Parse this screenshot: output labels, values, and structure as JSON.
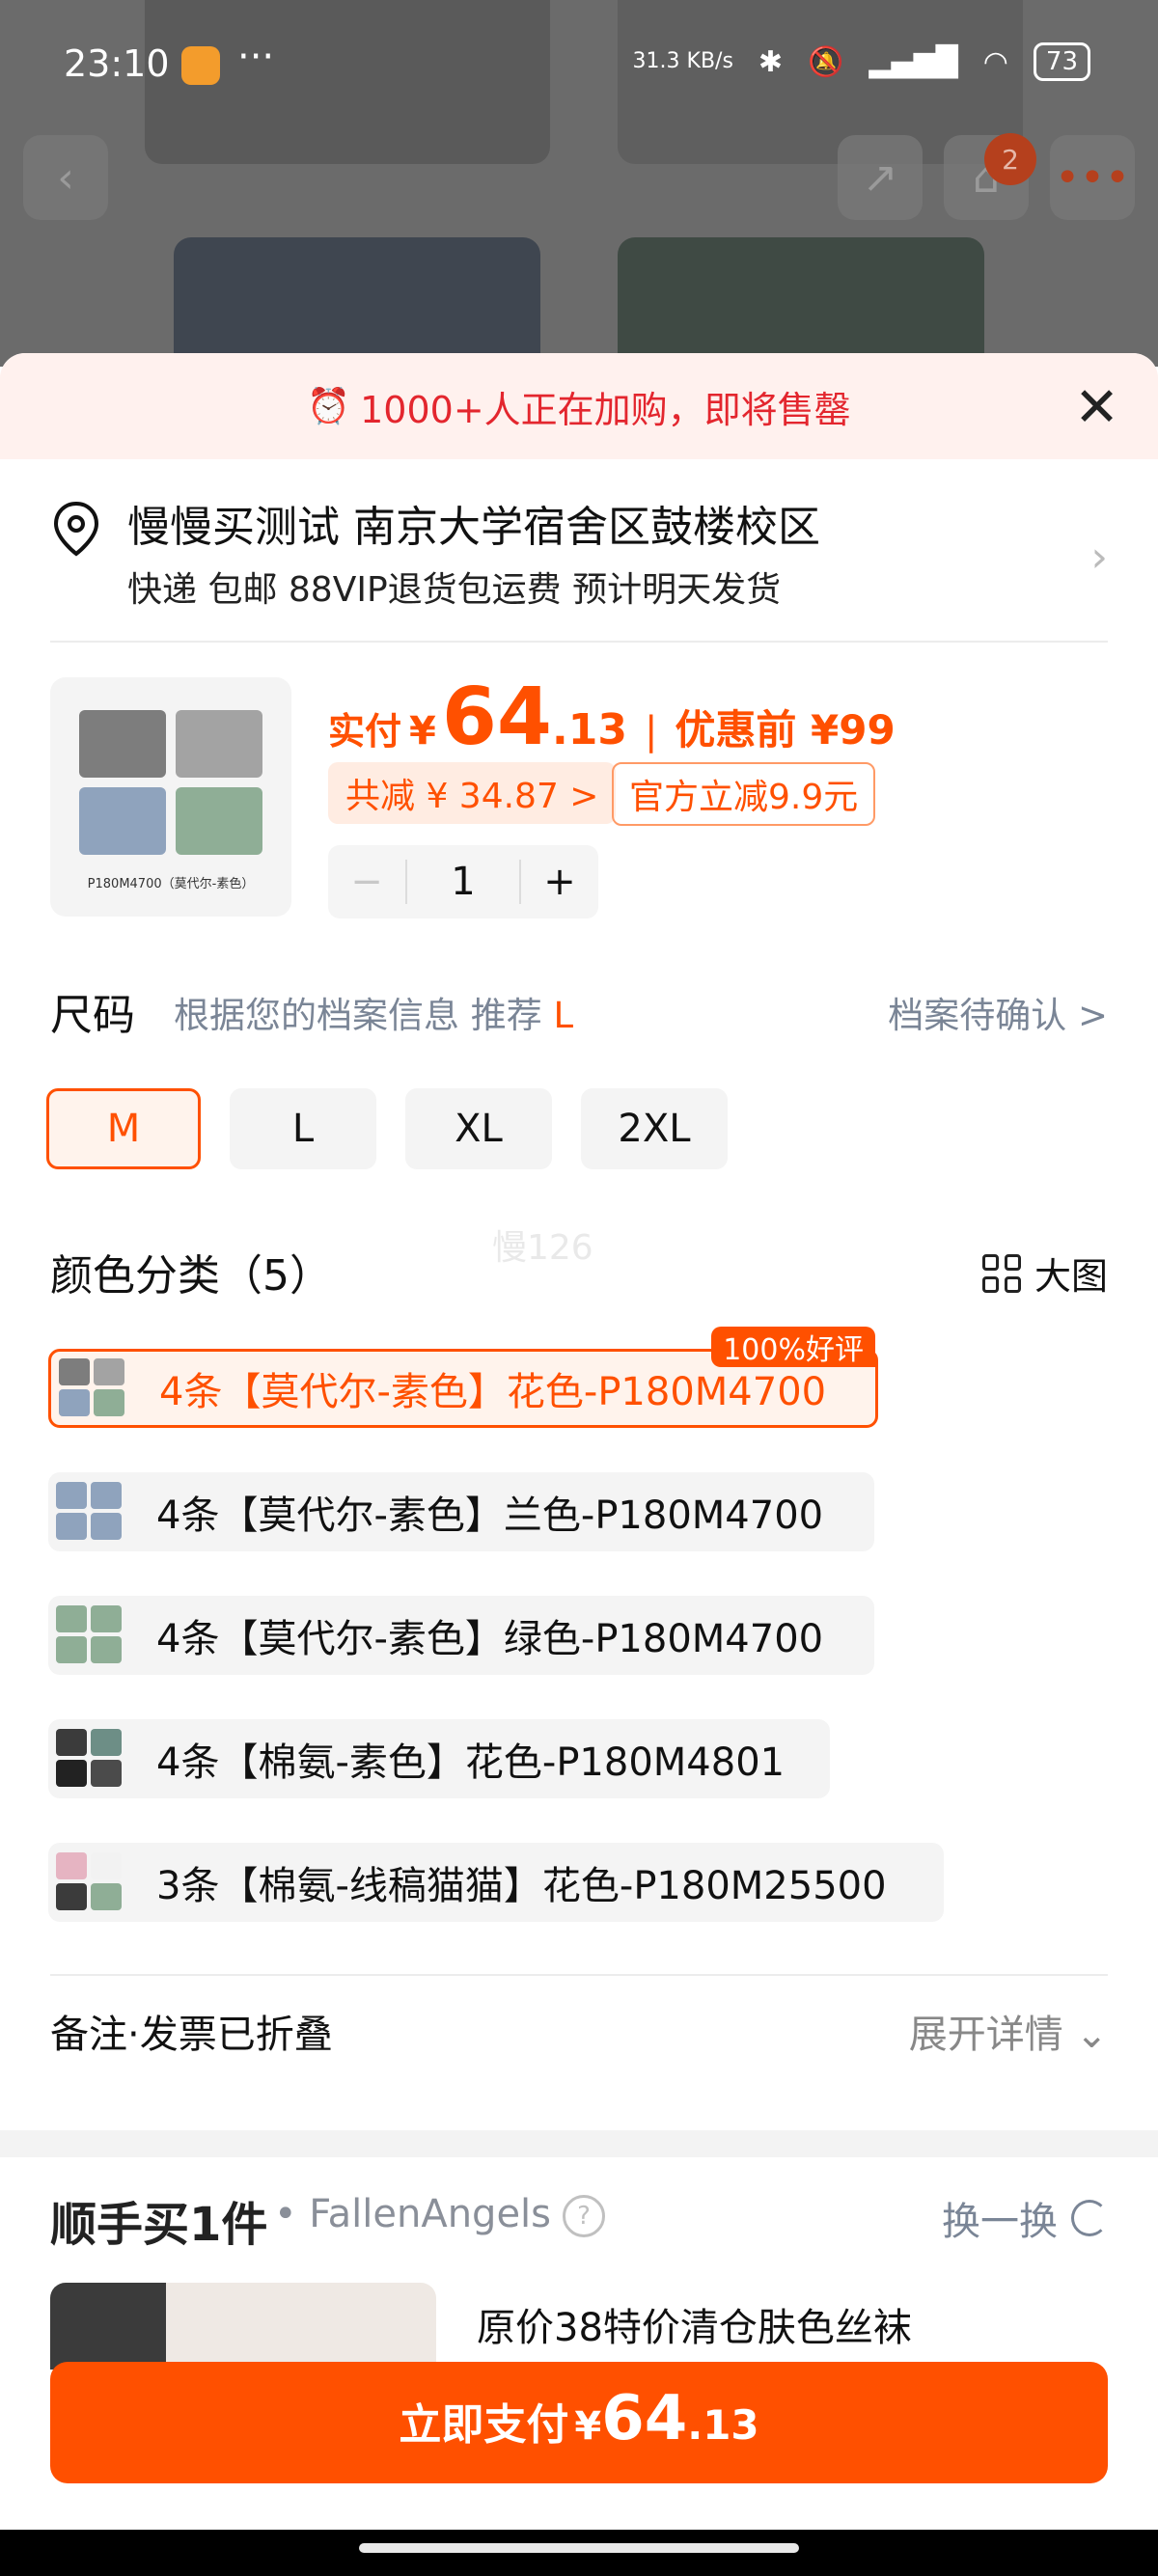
{
  "status_bar": {
    "time": "23:10",
    "more": "···",
    "net_speed": "31.3 KB/s",
    "battery": "73",
    "icons": [
      "app-notification-icon",
      "bluetooth-icon",
      "mute-icon",
      "signal-icon",
      "wifi-icon",
      "battery-icon"
    ]
  },
  "top_nav": {
    "cart_count": "2"
  },
  "promo": {
    "text": "1000+人正在加购，即将售罄",
    "close": "✕"
  },
  "address": {
    "line1": "慢慢买测试 南京大学宿舍区鼓楼校区",
    "line2": "快递 包邮 88VIP退货包运费 预计明天发货"
  },
  "product": {
    "thumb_caption": "P180M4700（莫代尔-素色）",
    "price_label": "实付",
    "currency": "¥",
    "price_main": "64",
    "price_cents": ".13",
    "separator": "|",
    "before_label": "优惠前 ¥99",
    "discount_chip": "共减 ¥ 34.87 >",
    "official_chip": "官方立减9.9元",
    "quantity": "1",
    "minus": "−",
    "plus": "+"
  },
  "size": {
    "title": "尺码",
    "hint": "根据您的档案信息 推荐",
    "recommended": "L",
    "profile_status": "档案待确认 >",
    "options": [
      "M",
      "L",
      "XL",
      "2XL"
    ],
    "selected": "M"
  },
  "watermark": "慢126",
  "color": {
    "title": "颜色分类（5）",
    "big_view": "大图",
    "options": [
      "4条【莫代尔-素色】花色-P180M4700",
      "4条【莫代尔-素色】兰色-P180M4700",
      "4条【莫代尔-素色】绿色-P180M4700",
      "4条【棉氨-素色】花色-P180M4801",
      "3条【棉氨-线稿猫猫】花色-P180M25500"
    ],
    "selected_index": 0,
    "selected_badge": "100%好评"
  },
  "remark": {
    "label": "备注·发票已折叠",
    "expand": "展开详情"
  },
  "addon": {
    "title_part1": "顺手",
    "title_part2": "买1件",
    "shop": "• FallenAngels",
    "help": "?",
    "swap": "换一换",
    "item_name": "原价38特价清仓肤色丝袜"
  },
  "pay": {
    "label": "立即支付",
    "currency": "¥",
    "amount_main": "64",
    "amount_cents": ".13"
  },
  "colors": {
    "accent": "#ff5000",
    "promo_red": "#e3262e",
    "muted": "#7a8596"
  }
}
